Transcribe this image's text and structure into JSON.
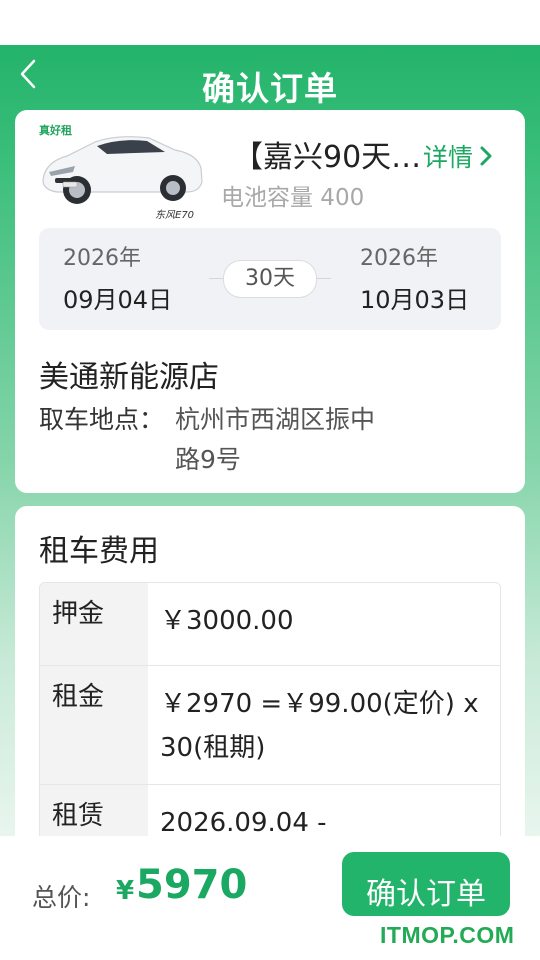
{
  "header": {
    "title": "确认订单",
    "back_icon": "chevron-left-icon"
  },
  "car": {
    "name": "【嘉兴90天…",
    "detail_label": "详情",
    "battery_label": "电池容量 400",
    "image_brand_text": "真好租",
    "image_model_text": "东风E70"
  },
  "rental_dates": {
    "start_year": "2026年",
    "start_date": "09月04日",
    "duration": "30天",
    "end_year": "2026年",
    "end_date": "10月03日"
  },
  "store": {
    "name": "美通新能源店",
    "pickup_label": "取车地点：",
    "pickup_address": "杭州市西湖区振中路9号"
  },
  "fees": {
    "title": "租车费用",
    "rows": [
      {
        "label": "押金",
        "value": "￥3000.00"
      },
      {
        "label": "租金",
        "value": "￥2970 =￥99.00(定价) x 30(租期)"
      },
      {
        "label": "租赁周期",
        "value": "2026.09.04 -"
      }
    ]
  },
  "footer": {
    "total_label": "总价:",
    "currency": "¥",
    "total_value": "5970",
    "confirm_label": "确认订单"
  },
  "watermark": "ITMOP.COM",
  "colors": {
    "accent": "#22b46b",
    "text": "#222222",
    "muted": "#a8a8a8"
  }
}
